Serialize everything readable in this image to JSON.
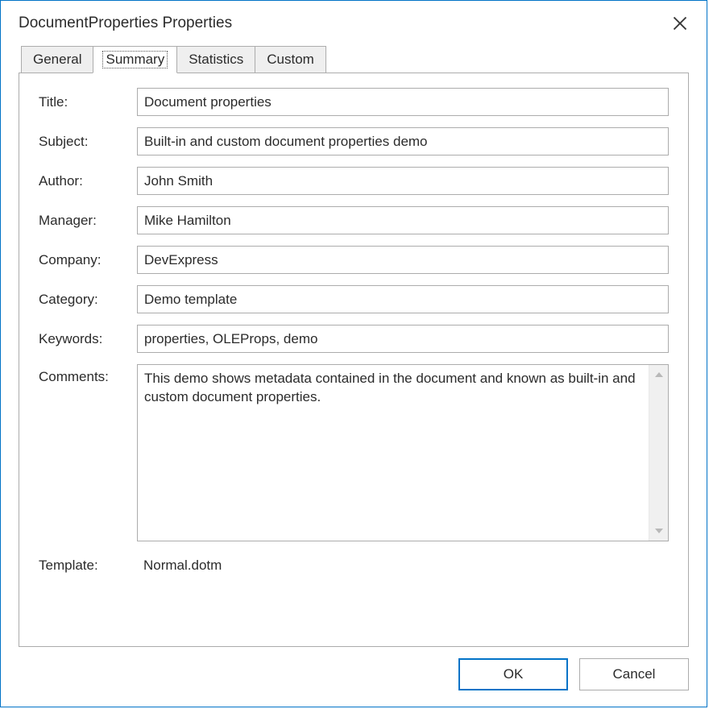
{
  "dialog": {
    "title": "DocumentProperties Properties"
  },
  "tabs": {
    "general": "General",
    "summary": "Summary",
    "statistics": "Statistics",
    "custom": "Custom"
  },
  "labels": {
    "title": "Title:",
    "subject": "Subject:",
    "author": "Author:",
    "manager": "Manager:",
    "company": "Company:",
    "category": "Category:",
    "keywords": "Keywords:",
    "comments": "Comments:",
    "template": "Template:"
  },
  "fields": {
    "title": "Document properties",
    "subject": "Built-in and custom document properties demo",
    "author": "John Smith",
    "manager": "Mike Hamilton",
    "company": "DevExpress",
    "category": "Demo template",
    "keywords": "properties, OLEProps, demo",
    "comments": "This demo shows metadata contained in the document and known as built-in and custom document properties.",
    "template": "Normal.dotm"
  },
  "buttons": {
    "ok": "OK",
    "cancel": "Cancel"
  }
}
